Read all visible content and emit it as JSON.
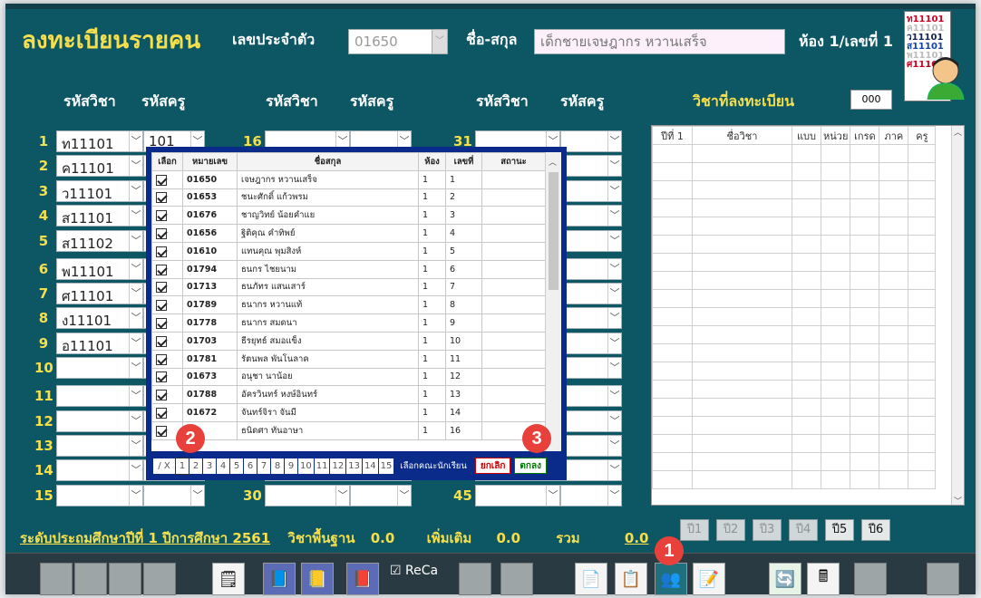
{
  "header": {
    "title": "ลงทะเบียนรายคน",
    "id_label": "เลขประจำตัว",
    "id_value": "01650",
    "name_label": "ชื่อ-สกุล",
    "name_value": "เด็กชายเจษฎากร  หวานเสร็จ",
    "room_label": "ห้อง 1/เลขที่ 1",
    "reg_label": "วิชาที่ลงทะเบียน",
    "reg_count": "000"
  },
  "logo": {
    "lines": [
      "ท11101",
      "ค11101",
      "ว11101",
      "ส11101",
      "พ11101",
      "ศ11101"
    ]
  },
  "col_headers": {
    "subject": "รหัสวิชา",
    "teacher": "รหัสครู"
  },
  "rows_left": [
    {
      "n": "1",
      "code": "ท11101",
      "teacher": "101"
    },
    {
      "n": "2",
      "code": "ค11101",
      "teacher": ""
    },
    {
      "n": "3",
      "code": "ว11101",
      "teacher": ""
    },
    {
      "n": "4",
      "code": "ส11101",
      "teacher": ""
    },
    {
      "n": "5",
      "code": "ส11102",
      "teacher": ""
    },
    {
      "n": "6",
      "code": "พ11101",
      "teacher": ""
    },
    {
      "n": "7",
      "code": "ศ11101",
      "teacher": ""
    },
    {
      "n": "8",
      "code": "ง11101",
      "teacher": ""
    },
    {
      "n": "9",
      "code": "อ11101",
      "teacher": ""
    },
    {
      "n": "10",
      "code": "",
      "teacher": ""
    },
    {
      "n": "11",
      "code": "",
      "teacher": ""
    },
    {
      "n": "12",
      "code": "",
      "teacher": ""
    },
    {
      "n": "13",
      "code": "",
      "teacher": ""
    },
    {
      "n": "14",
      "code": "",
      "teacher": ""
    },
    {
      "n": "15",
      "code": "",
      "teacher": ""
    }
  ],
  "row_nums_mid": {
    "first": "16",
    "last": "30"
  },
  "row_nums_right": {
    "first": "31",
    "last": "45"
  },
  "modal": {
    "headers": [
      "เลือก",
      "หมายเลข",
      "ชื่อสกุล",
      "ห้อง",
      "เลขที่",
      "สถานะ"
    ],
    "rows": [
      {
        "id": "01650",
        "name": "เจษฎากร หวานเสร็จ",
        "room": "1",
        "no": "1"
      },
      {
        "id": "01653",
        "name": "ชนะศักดิ์ แก้วพรม",
        "room": "1",
        "no": "2"
      },
      {
        "id": "01676",
        "name": "ชาญวิทย์ น้อยคำแย",
        "room": "1",
        "no": "3"
      },
      {
        "id": "01656",
        "name": "ฐิติคุณ คำทิพย์",
        "room": "1",
        "no": "4"
      },
      {
        "id": "01610",
        "name": "แทนคุณ พุมสิงห์",
        "room": "1",
        "no": "5"
      },
      {
        "id": "01794",
        "name": "ธนกร ไชยนาม",
        "room": "1",
        "no": "6"
      },
      {
        "id": "01713",
        "name": "ธนภัทร แสนเสาร์",
        "room": "1",
        "no": "7"
      },
      {
        "id": "01789",
        "name": "ธนากร หวานแท้",
        "room": "1",
        "no": "8"
      },
      {
        "id": "01778",
        "name": "ธนากร สมดนา",
        "room": "1",
        "no": "9"
      },
      {
        "id": "01703",
        "name": "ธีรยุทธ์ สมอแข็ง",
        "room": "1",
        "no": "10"
      },
      {
        "id": "01781",
        "name": "รัตนพล พันโนลาค",
        "room": "1",
        "no": "11"
      },
      {
        "id": "01673",
        "name": "อนุชา นาน้อย",
        "room": "1",
        "no": "12"
      },
      {
        "id": "01788",
        "name": "อัครวินทร์ หงษ์อินทร์",
        "room": "1",
        "no": "13"
      },
      {
        "id": "01672",
        "name": "จันทร์จิรา จันมี",
        "room": "1",
        "no": "14"
      },
      {
        "id": "",
        "name": "ธนิดศา ทันอาษา",
        "room": "1",
        "no": "16"
      }
    ],
    "check_label": "/ X",
    "pages": [
      "1",
      "2",
      "3",
      "4",
      "5",
      "6",
      "7",
      "8",
      "9",
      "10",
      "11",
      "12",
      "13",
      "14",
      "15"
    ],
    "select_label": "เลือกคณะนักเรียน",
    "cancel": "ยกเลิก",
    "ok": "ตกลง"
  },
  "right_table": {
    "headers": [
      "ปีที่ 1",
      "ชื่อวิชา",
      "แบบ",
      "หน่วย",
      "เกรด",
      "ภาค",
      "ครู"
    ]
  },
  "year_buttons": [
    "ปี1",
    "ปี2",
    "ปี3",
    "ปี4",
    "ปี5",
    "ปี6"
  ],
  "footer": {
    "level": "ระดับประถมศึกษาปีที่ 1  ปีการศึกษา 2561",
    "basic_label": "วิชาพื้นฐาน",
    "basic": "0.0",
    "extra_label": "เพิ่มเติม",
    "extra": "0.0",
    "total_label": "รวม",
    "total": "0.0"
  },
  "recalc": "ReCa",
  "badges": [
    "1",
    "2",
    "3"
  ],
  "toolbar_icons": [
    "form-icon",
    "notebook-icon",
    "notebook-2-icon",
    "book-icon",
    "copy-icon",
    "paste-icon",
    "students-group-icon",
    "checklist-icon",
    "refresh-icon",
    "calculator-icon"
  ]
}
